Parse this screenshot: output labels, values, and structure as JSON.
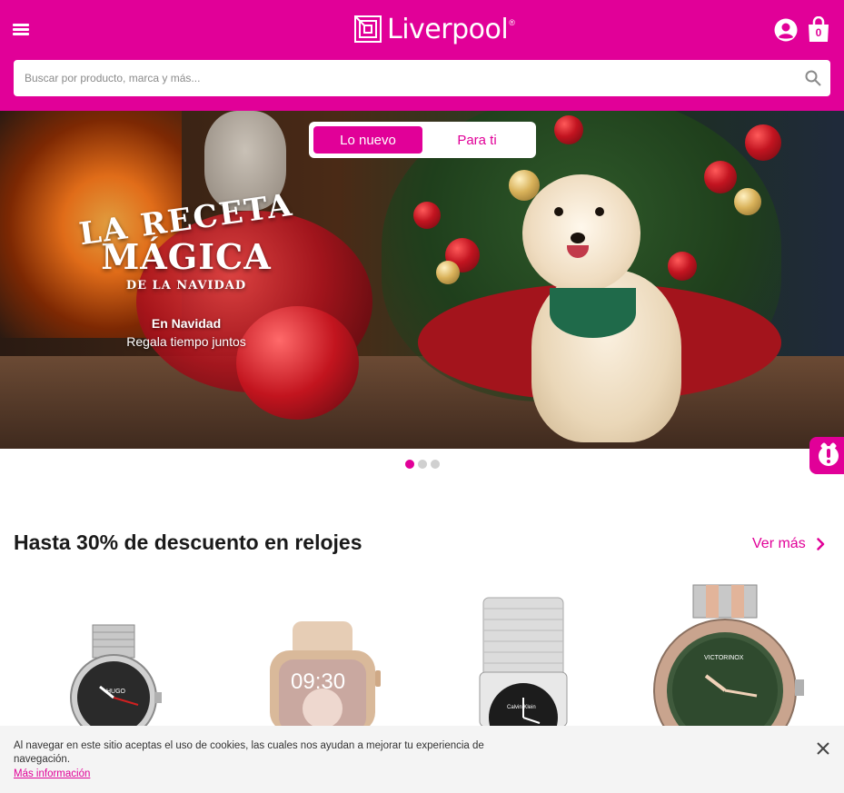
{
  "header": {
    "brand": "Liverpool",
    "brand_mark": "®",
    "bag_count": "0",
    "bg_color": "#e10098"
  },
  "search": {
    "placeholder": "Buscar por producto, marca y más..."
  },
  "hero": {
    "toggle": {
      "active_label": "Lo nuevo",
      "inactive_label": "Para ti"
    },
    "title_line1": "LA RECETA",
    "title_line2": "MÁGICA",
    "title_line3": "DE LA NAVIDAD",
    "subtitle_bold": "En Navidad",
    "subtitle": "Regala tiempo juntos",
    "slides_total": 3,
    "slide_active": 1
  },
  "section": {
    "title": "Hasta 30% de descuento en relojes",
    "see_more": "Ver más"
  },
  "products": [
    {
      "name": "hugo-watch",
      "face_text": "HUGO"
    },
    {
      "name": "smartwatch",
      "face_text": "09:30"
    },
    {
      "name": "calvin-klein-watch",
      "face_text": "Calvin Klein"
    },
    {
      "name": "victorinox-watch",
      "face_text": "VICTORINOX"
    }
  ],
  "cookie": {
    "text": "Al navegar en este sitio aceptas el uso de cookies, las cuales nos ayudan a mejorar tu experiencia de navegación.",
    "link": "Más información"
  },
  "icons": [
    "menu-icon",
    "liverpool-logo-icon",
    "account-icon",
    "shopping-bag-icon",
    "search-icon",
    "chat-icon",
    "chevron-right-icon",
    "close-icon"
  ]
}
